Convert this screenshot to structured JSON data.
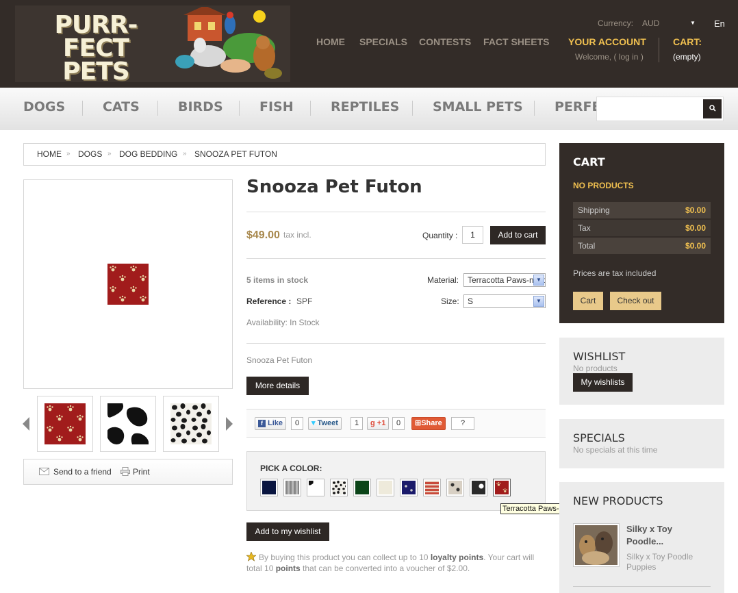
{
  "header": {
    "logo_text_line1": "PURR-FECT",
    "logo_text_line2": "PETS",
    "nav": [
      "HOME",
      "SPECIALS",
      "CONTESTS",
      "FACT SHEETS"
    ],
    "currency_label": "Currency:",
    "currency_value": "AUD",
    "language": "En",
    "your_account": "YOUR ACCOUNT",
    "welcome": "Welcome, ( log in )",
    "cart_label": "CART:",
    "cart_status": "(empty)"
  },
  "categories": [
    "DOGS",
    "CATS",
    "BIRDS",
    "FISH",
    "REPTILES",
    "SMALL PETS",
    "PERFECT PETZZZ"
  ],
  "search": {
    "placeholder": "",
    "icon": "search-icon"
  },
  "breadcrumb": [
    "HOME",
    "DOGS",
    "DOG BEDDING",
    "SNOOZA PET FUTON"
  ],
  "product": {
    "title": "Snooza Pet Futon",
    "price": "$49.00",
    "tax_note": "tax incl.",
    "quantity_label": "Quantity :",
    "quantity": "1",
    "add_to_cart": "Add to cart",
    "stock": "5 items in stock",
    "reference_label": "Reference :",
    "reference": "SPF",
    "availability": "Availability: In Stock",
    "material_label": "Material:",
    "material_value": "Terracotta Paws-n-Bones",
    "size_label": "Size:",
    "size_value": "S",
    "short_description": "Snooza Pet Futon",
    "more_details": "More details",
    "send_to_friend": "Send to a friend",
    "print": "Print",
    "add_to_wishlist": "Add to my wishlist",
    "loyalty_prefix": "By buying this product you can collect up to 10 ",
    "loyalty_points_label": "loyalty points",
    "loyalty_middle": ". Your cart will total 10 ",
    "loyalty_points_word": "points",
    "loyalty_suffix": " that can be converted into a voucher of $2.00."
  },
  "social": {
    "like": "Like",
    "like_count": "0",
    "tweet": "Tweet",
    "tweet_count": "1",
    "plus_one": "+1",
    "plus_count": "0",
    "share": "Share",
    "share_count": "?"
  },
  "color_picker": {
    "title": "PICK A COLOR:",
    "swatches": [
      "navy",
      "grey-plaid",
      "cow-print",
      "dalmatian",
      "green",
      "cream",
      "blue-paws",
      "red-plaid",
      "leopard",
      "grey-cow",
      "terracotta-paws"
    ],
    "tooltip": "Terracotta Paws-n-Bones"
  },
  "colors": {
    "header_bg": "#332c28",
    "accent_gold": "#f0c050",
    "price": "#a8884d",
    "button_dark": "#2e2825",
    "button_gold": "#e8c98a",
    "swatch_red": "#a11c1c"
  },
  "cart_block": {
    "title": "CART",
    "no_products": "NO PRODUCTS",
    "rows": [
      {
        "label": "Shipping",
        "value": "$0.00"
      },
      {
        "label": "Tax",
        "value": "$0.00"
      },
      {
        "label": "Total",
        "value": "$0.00"
      }
    ],
    "prices_note": "Prices are tax included",
    "cart_button": "Cart",
    "checkout_button": "Check out"
  },
  "wishlist_block": {
    "title": "WISHLIST",
    "subtitle": "No products",
    "button": "My wishlists"
  },
  "specials_block": {
    "title": "SPECIALS",
    "subtitle": "No specials at this time"
  },
  "new_products_block": {
    "title": "NEW PRODUCTS",
    "item_name": "Silky x Toy Poodle...",
    "item_desc": "Silky x Toy Poodle Puppies"
  }
}
